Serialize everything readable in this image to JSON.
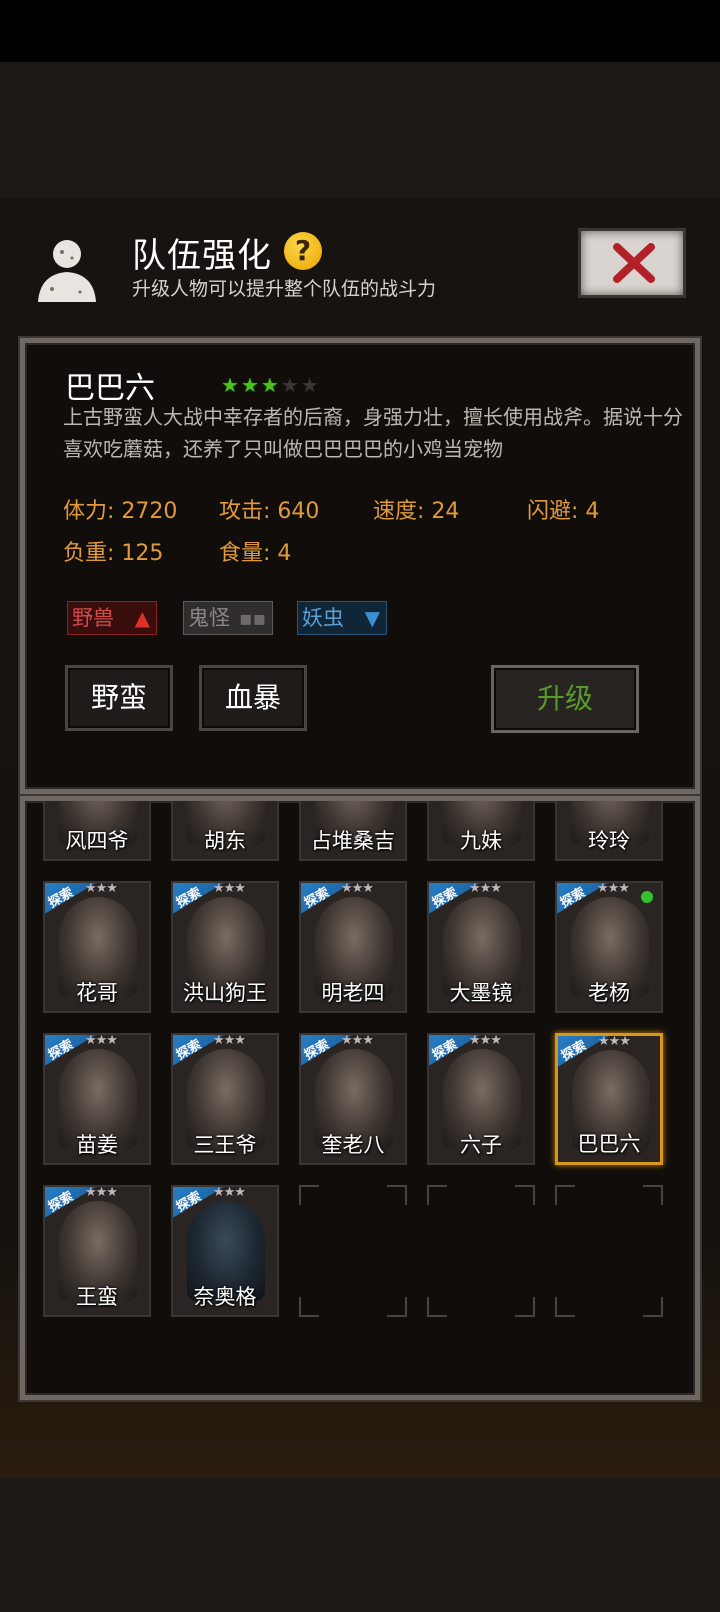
{
  "header": {
    "title": "队伍强化",
    "help_symbol": "?",
    "subtitle": "升级人物可以提升整个队伍的战斗力",
    "avatar_icon": "silhouette-icon",
    "close_icon": "red-x-icon"
  },
  "hero": {
    "name": "巴巴六",
    "stars_filled": 3,
    "stars_total": 5,
    "description": "上古野蛮人大战中幸存者的后裔，身强力壮，擅长使用战斧。据说十分喜欢吃蘑菇，还养了只叫做巴巴巴巴的小鸡当宠物",
    "stats": {
      "hp_label": "体力:",
      "hp_value": "2720",
      "atk_label": "攻击:",
      "atk_value": "640",
      "spd_label": "速度:",
      "spd_value": "24",
      "dodge_label": "闪避:",
      "dodge_value": "4",
      "load_label": "负重:",
      "load_value": "125",
      "food_label": "食量:",
      "food_value": "4"
    },
    "tags": [
      {
        "label": "野兽",
        "indicator": "up-arrow",
        "color": "#d24b4b"
      },
      {
        "label": "鬼怪",
        "indicator": "neutral",
        "color": "#8a8784"
      },
      {
        "label": "妖虫",
        "indicator": "down-arrow",
        "color": "#5aa0d4"
      }
    ],
    "skills": [
      "野蛮",
      "血暴"
    ],
    "upgrade_label": "升级"
  },
  "roster": {
    "badge_text": "探索",
    "star_glyphs": "★★★",
    "row0": [
      "风四爷",
      "胡东",
      "占堆桑吉",
      "九妹",
      "玲玲"
    ],
    "row1": [
      "花哥",
      "洪山狗王",
      "明老四",
      "大墨镜",
      "老杨"
    ],
    "row2": [
      "苗姜",
      "三王爷",
      "奎老八",
      "六子",
      "巴巴六"
    ],
    "row3": [
      "王蛮",
      "奈奥格"
    ],
    "selected": "巴巴六",
    "accent": "#d9961c"
  }
}
